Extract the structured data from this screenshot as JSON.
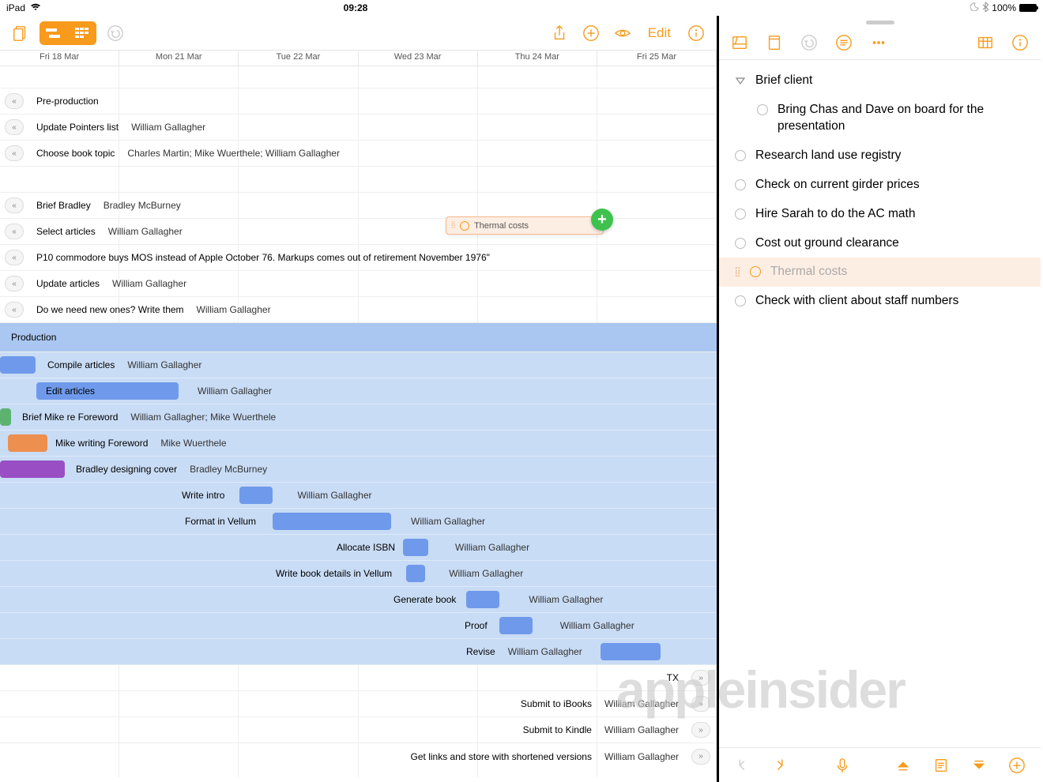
{
  "statusbar": {
    "device": "iPad",
    "time": "09:28",
    "battery": "100%"
  },
  "left_toolbar": {
    "edit": "Edit"
  },
  "days": [
    "Fri 18 Mar",
    "Mon 21 Mar",
    "Tue 22 Mar",
    "Wed 23 Mar",
    "Thu 24 Mar",
    "Fri 25 Mar"
  ],
  "floating_task": "Thermal costs",
  "rows_top": [
    {
      "label": "Pre-production",
      "assignee": ""
    },
    {
      "label": "Update Pointers list",
      "assignee": "William Gallagher"
    },
    {
      "label": "Choose book topic",
      "assignee": "Charles Martin; Mike Wuerthele; William Gallagher"
    }
  ],
  "rows_mid": [
    {
      "label": "Brief Bradley",
      "assignee": "Bradley McBurney"
    },
    {
      "label": "Select articles",
      "assignee": "William Gallagher"
    },
    {
      "label": "P10 commodore buys MOS instead of Apple October 76. Markups comes out of retirement November 1976\"",
      "assignee": ""
    },
    {
      "label": "Update articles",
      "assignee": "William Gallagher"
    },
    {
      "label": "Do we need new ones? Write them",
      "assignee": "William Gallagher"
    }
  ],
  "production_header": "Production",
  "production": [
    {
      "label": "Compile articles",
      "assignee": "William Gallagher"
    },
    {
      "label": "Edit articles",
      "assignee": "William Gallagher"
    },
    {
      "label": "Brief Mike re Foreword",
      "assignee": "William Gallagher; Mike Wuerthele"
    },
    {
      "label": "Mike writing Foreword",
      "assignee": "Mike Wuerthele"
    },
    {
      "label": "Bradley designing cover",
      "assignee": "Bradley McBurney"
    },
    {
      "label": "Write intro",
      "assignee": "William Gallagher"
    },
    {
      "label": "Format in Vellum",
      "assignee": "William Gallagher"
    },
    {
      "label": "Allocate ISBN",
      "assignee": "William Gallagher"
    },
    {
      "label": "Write book details in Vellum",
      "assignee": "William Gallagher"
    },
    {
      "label": "Generate book",
      "assignee": "William Gallagher"
    },
    {
      "label": "Proof",
      "assignee": "William Gallagher"
    },
    {
      "label": "Revise",
      "assignee": "William Gallagher"
    }
  ],
  "tx": "TX",
  "rows_bottom": [
    {
      "label": "Submit to iBooks",
      "assignee": "William Gallagher"
    },
    {
      "label": "Submit to Kindle",
      "assignee": "William Gallagher"
    },
    {
      "label": "Get links and store with shortened versions",
      "assignee": "William Gallagher"
    }
  ],
  "outline": {
    "parent": "Brief client",
    "items": [
      "Bring Chas and Dave on board for the presentation",
      "Research land use registry",
      "Check on current girder prices",
      "Hire Sarah to do the AC math",
      "Cost out ground clearance",
      "Thermal costs",
      "Check with client about staff numbers"
    ],
    "selected_index": 5
  }
}
